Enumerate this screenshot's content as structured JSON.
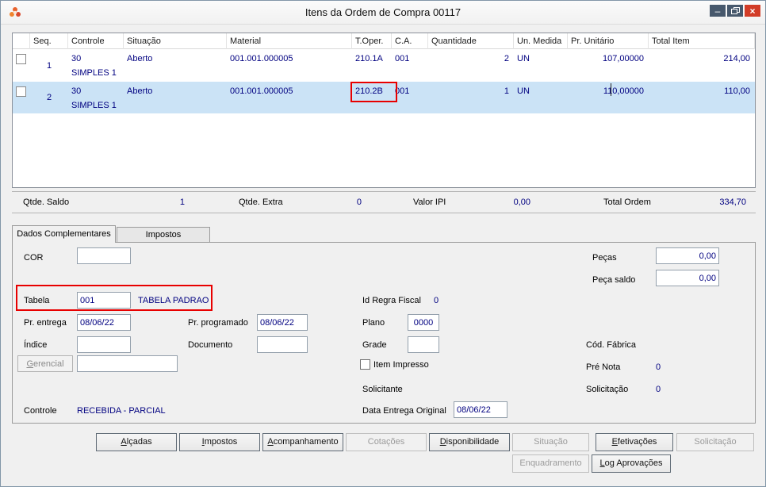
{
  "window": {
    "title": "Itens da Ordem de Compra 00117",
    "controls": {
      "minimize": "–",
      "close": "×"
    }
  },
  "grid": {
    "headers": [
      "Seq.",
      "Controle",
      "Situação",
      "Material",
      "T.Oper.",
      "C.A.",
      "Quantidade",
      "Un. Medida",
      "Pr. Unitário",
      "Total Item"
    ],
    "rows": [
      {
        "seq": "1",
        "controle": "30",
        "controle2": "SIMPLES 1",
        "situacao": "Aberto",
        "material": "001.001.000005",
        "toper": "210.1A",
        "ca": "001",
        "qtd": "2",
        "un": "UN",
        "preco": "107,00000",
        "total": "214,00"
      },
      {
        "seq": "2",
        "controle": "30",
        "controle2": "SIMPLES 1",
        "situacao": "Aberto",
        "material": "001.001.000005",
        "toper": "210.2B",
        "ca": "001",
        "qtd": "1",
        "un": "UN",
        "preco": "110,00000",
        "total": "110,00"
      }
    ]
  },
  "summary": {
    "qtde_saldo_label": "Qtde. Saldo",
    "qtde_saldo": "1",
    "qtde_extra_label": "Qtde. Extra",
    "qtde_extra": "0",
    "valor_ipi_label": "Valor IPI",
    "valor_ipi": "0,00",
    "total_ordem_label": "Total Ordem",
    "total_ordem": "334,70"
  },
  "tabs": {
    "dados_complementares": "Dados Complementares",
    "impostos": "Impostos"
  },
  "fields": {
    "cor_label": "COR",
    "cor_value": "",
    "pecas_label": "Peças",
    "pecas_value": "0,00",
    "peca_saldo_label": "Peça saldo",
    "peca_saldo_value": "0,00",
    "tabela_label": "Tabela",
    "tabela_value": "001",
    "tabela_desc": "TABELA PADRAO",
    "id_regra_fiscal_label": "Id Regra Fiscal",
    "id_regra_fiscal_value": "0",
    "pr_entrega_label": "Pr. entrega",
    "pr_entrega_value": "08/06/22",
    "pr_programado_label": "Pr. programado",
    "pr_programado_value": "08/06/22",
    "plano_label": "Plano",
    "plano_value": "0000",
    "indice_label": "Índice",
    "indice_value": "",
    "documento_label": "Documento",
    "documento_value": "",
    "grade_label": "Grade",
    "grade_value": "",
    "cod_fabrica_label": "Cód. Fábrica",
    "gerencial_label": "Gerencial",
    "gerencial_value": "",
    "item_impresso_label": "Item Impresso",
    "pre_nota_label": "Pré Nota",
    "pre_nota_value": "0",
    "solicitante_label": "Solicitante",
    "solicitacao_label": "Solicitação",
    "solicitacao_value": "0",
    "controle_label": "Controle",
    "controle_value": "RECEBIDA - PARCIAL",
    "data_entrega_original_label": "Data Entrega Original",
    "data_entrega_original_value": "08/06/22"
  },
  "buttons": {
    "alcadas": "Alçadas",
    "impostos": "Impostos",
    "acompanhamento": "Acompanhamento",
    "cotacoes": "Cotações",
    "disponibilidade": "Disponibilidade",
    "situacao": "Situação",
    "efetivacoes": "Efetivações",
    "solicitacao": "Solicitação",
    "enquadramento": "Enquadramento",
    "log_aprovacoes": "Log Aprovações"
  },
  "colors": {
    "value_text": "#000080",
    "row_selection": "#cbe3f6",
    "annotation_red": "#e80000",
    "close_button": "#d23c27"
  }
}
